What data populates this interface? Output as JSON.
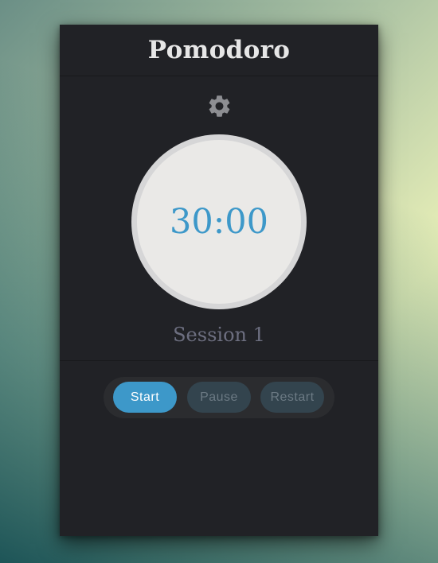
{
  "app": {
    "title": "Pomodoro"
  },
  "settings": {
    "icon": "gear-icon"
  },
  "timer": {
    "display": "30:00"
  },
  "session": {
    "label": "Session 1"
  },
  "controls": {
    "start_label": "Start",
    "pause_label": "Pause",
    "restart_label": "Restart"
  },
  "colors": {
    "accent": "#3d98c9",
    "panel": "#212226",
    "dial": "#eae9e7",
    "disabled_button": "#33444e"
  }
}
